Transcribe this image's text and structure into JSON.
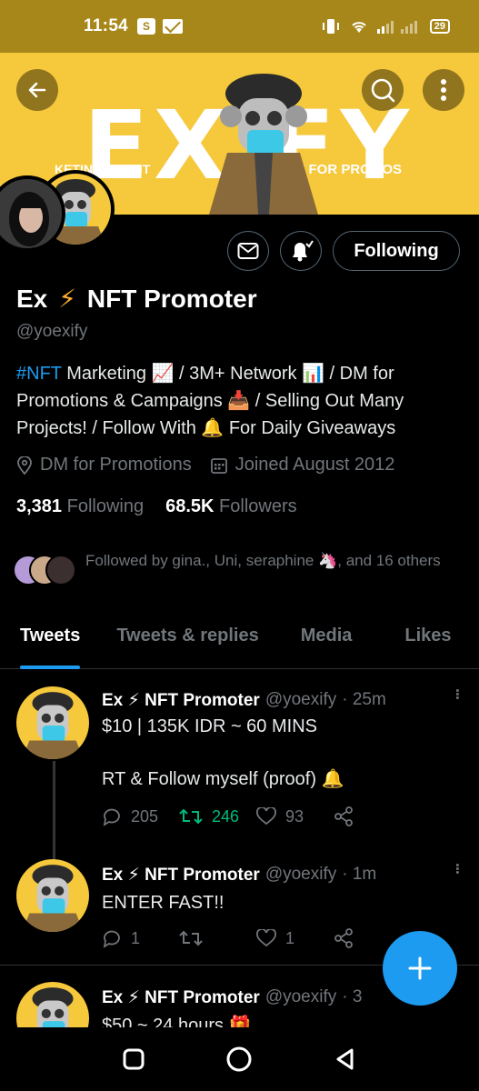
{
  "status_bar": {
    "time": "11:54",
    "shopping_label": "S",
    "battery": "29"
  },
  "banner": {
    "word": "EX  FY",
    "left_text": "KETING AGENT",
    "right_text": "DM FOR PROMOS"
  },
  "actions": {
    "following_label": "Following"
  },
  "profile": {
    "name": "Ex",
    "name_suffix": "NFT Promoter",
    "bolt": "⚡",
    "handle": "@yoexify",
    "bio_hashtag": "#NFT",
    "bio_rest": " Marketing 📈 / 3M+ Network 📊 / DM for Promotions & Campaigns 📥 / Selling Out Many Projects! / Follow With 🔔 For Daily Giveaways",
    "location": "DM for Promotions",
    "joined": "Joined August 2012",
    "following_count": "3,381",
    "following_label": "Following",
    "followers_count": "68.5K",
    "followers_label": "Followers",
    "followed_by": "Followed by gina., Uni, seraphine 🦄, and 16 others"
  },
  "tabs": [
    {
      "label": "Tweets"
    },
    {
      "label": "Tweets & replies"
    },
    {
      "label": "Media"
    },
    {
      "label": "Likes"
    }
  ],
  "tweets": [
    {
      "name": "Ex ⚡ NFT Promoter",
      "handle": "@yoexify",
      "time": "· 25m",
      "text": "$10 | 135K IDR ~ 60 MINS\n\nRT & Follow myself (proof) 🔔",
      "replies": "205",
      "retweets": "246",
      "likes": "93"
    },
    {
      "name": "Ex ⚡ NFT Promoter",
      "handle": "@yoexify",
      "time": "· 1m",
      "text": "ENTER FAST!!",
      "replies": "1",
      "retweets": "",
      "likes": "1"
    },
    {
      "name": "Ex ⚡ NFT Promoter",
      "handle": "@yoexify",
      "time": "· 3",
      "text": "$50 ~ 24 hours 🎁",
      "replies": "",
      "retweets": "",
      "likes": ""
    }
  ],
  "colors": {
    "accent": "#1d9bf0",
    "banner": "#f6c83c",
    "status_bar": "#a8871a",
    "retweet_green": "#00ba7c",
    "muted": "#71767b"
  }
}
